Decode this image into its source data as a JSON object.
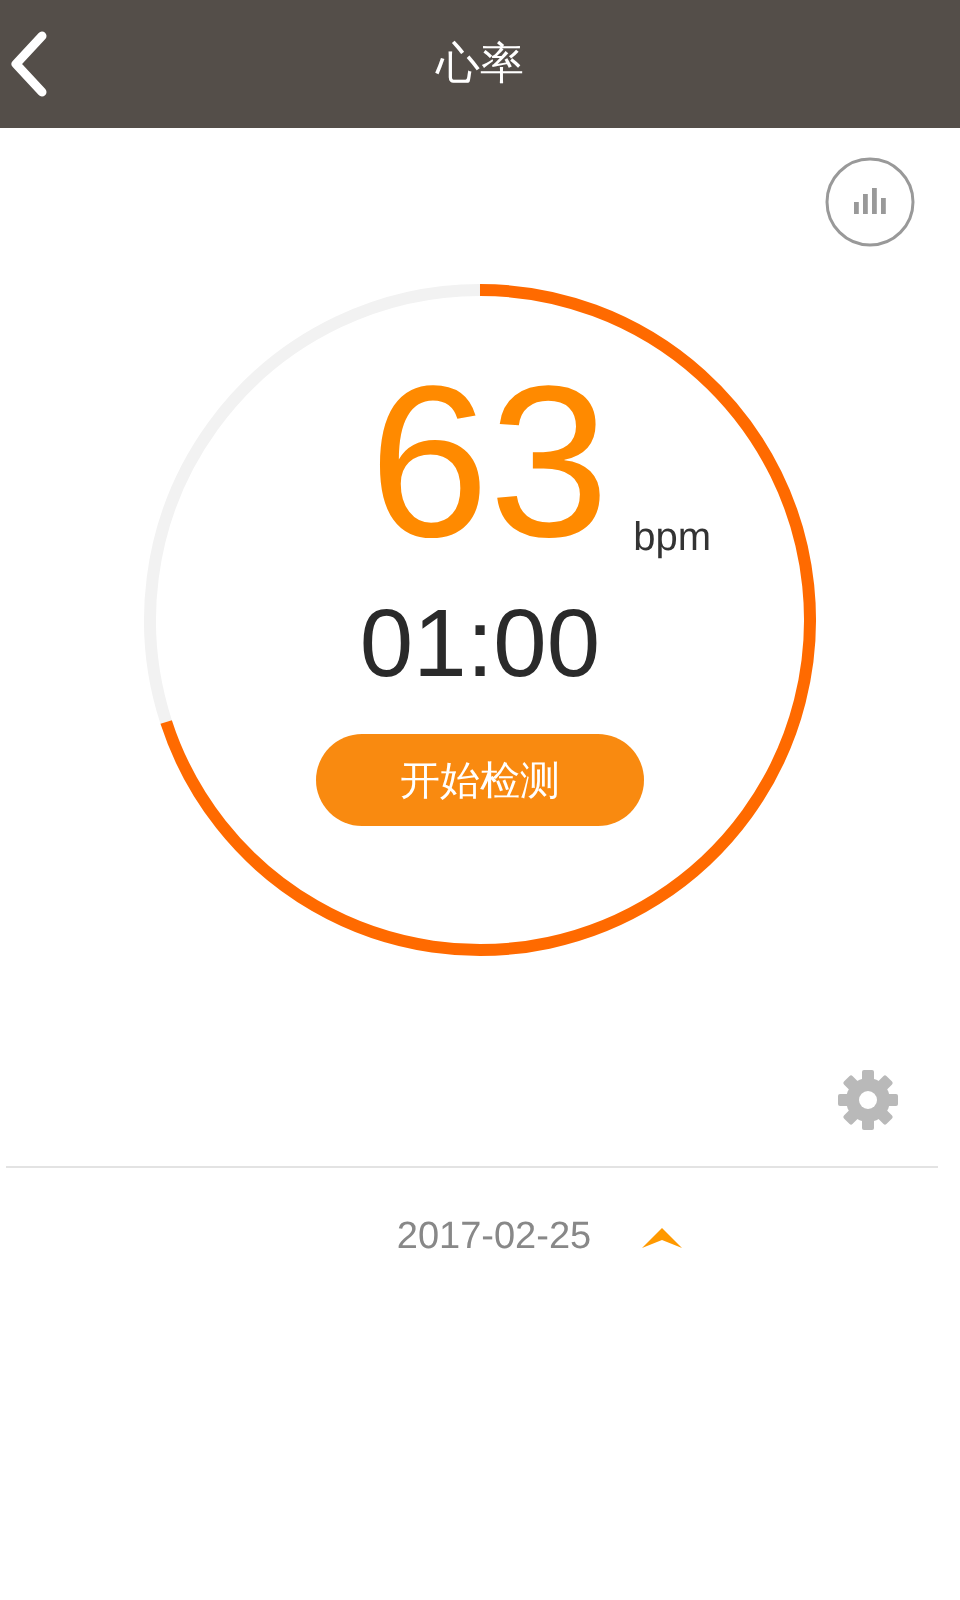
{
  "header": {
    "title": "心率"
  },
  "measurement": {
    "value": "63",
    "unit": "bpm",
    "timer": "01:00",
    "button": "开始检测"
  },
  "history": {
    "date": "2017-02-25",
    "expanded": true
  }
}
